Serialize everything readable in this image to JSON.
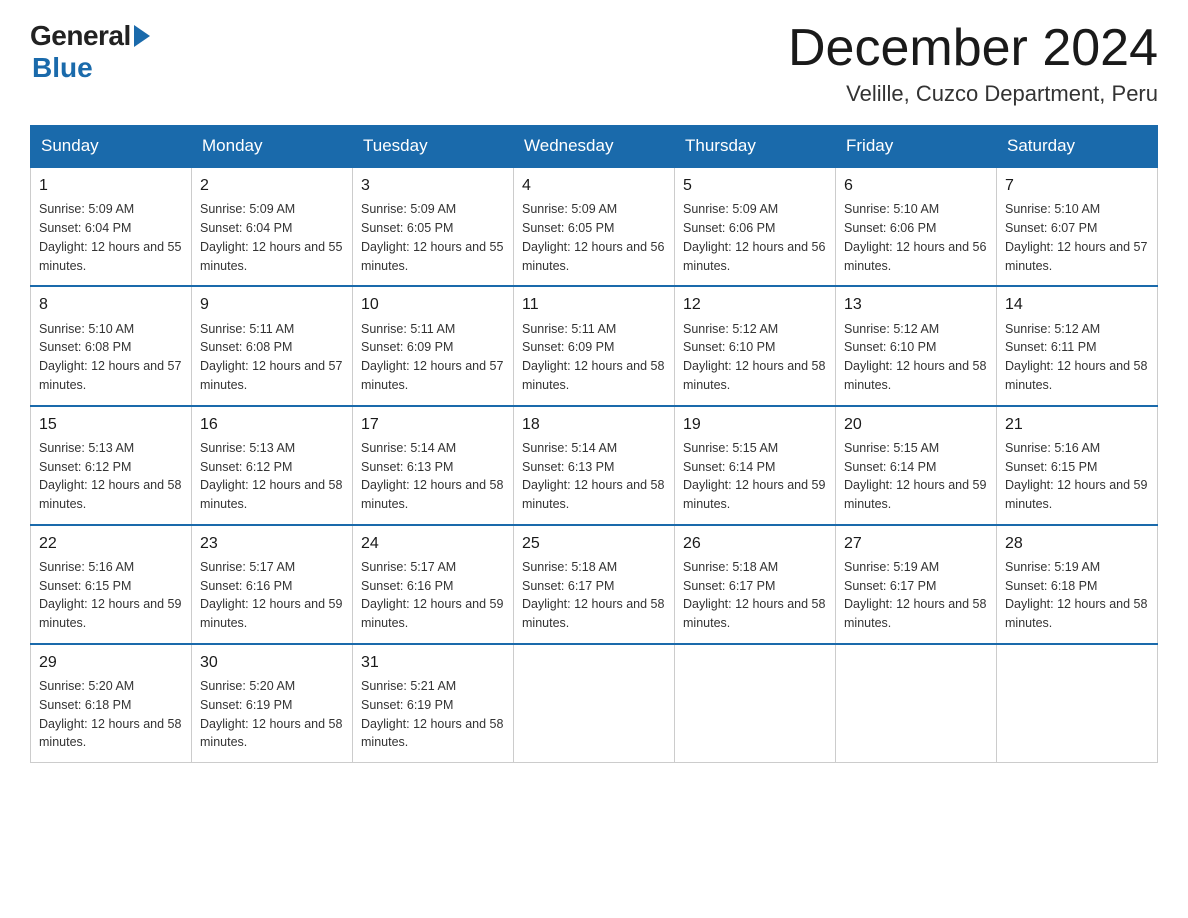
{
  "header": {
    "month_year": "December 2024",
    "location": "Velille, Cuzco Department, Peru"
  },
  "days_of_week": [
    "Sunday",
    "Monday",
    "Tuesday",
    "Wednesday",
    "Thursday",
    "Friday",
    "Saturday"
  ],
  "weeks": [
    [
      {
        "day": "1",
        "sunrise": "5:09 AM",
        "sunset": "6:04 PM",
        "daylight": "12 hours and 55 minutes."
      },
      {
        "day": "2",
        "sunrise": "5:09 AM",
        "sunset": "6:04 PM",
        "daylight": "12 hours and 55 minutes."
      },
      {
        "day": "3",
        "sunrise": "5:09 AM",
        "sunset": "6:05 PM",
        "daylight": "12 hours and 55 minutes."
      },
      {
        "day": "4",
        "sunrise": "5:09 AM",
        "sunset": "6:05 PM",
        "daylight": "12 hours and 56 minutes."
      },
      {
        "day": "5",
        "sunrise": "5:09 AM",
        "sunset": "6:06 PM",
        "daylight": "12 hours and 56 minutes."
      },
      {
        "day": "6",
        "sunrise": "5:10 AM",
        "sunset": "6:06 PM",
        "daylight": "12 hours and 56 minutes."
      },
      {
        "day": "7",
        "sunrise": "5:10 AM",
        "sunset": "6:07 PM",
        "daylight": "12 hours and 57 minutes."
      }
    ],
    [
      {
        "day": "8",
        "sunrise": "5:10 AM",
        "sunset": "6:08 PM",
        "daylight": "12 hours and 57 minutes."
      },
      {
        "day": "9",
        "sunrise": "5:11 AM",
        "sunset": "6:08 PM",
        "daylight": "12 hours and 57 minutes."
      },
      {
        "day": "10",
        "sunrise": "5:11 AM",
        "sunset": "6:09 PM",
        "daylight": "12 hours and 57 minutes."
      },
      {
        "day": "11",
        "sunrise": "5:11 AM",
        "sunset": "6:09 PM",
        "daylight": "12 hours and 58 minutes."
      },
      {
        "day": "12",
        "sunrise": "5:12 AM",
        "sunset": "6:10 PM",
        "daylight": "12 hours and 58 minutes."
      },
      {
        "day": "13",
        "sunrise": "5:12 AM",
        "sunset": "6:10 PM",
        "daylight": "12 hours and 58 minutes."
      },
      {
        "day": "14",
        "sunrise": "5:12 AM",
        "sunset": "6:11 PM",
        "daylight": "12 hours and 58 minutes."
      }
    ],
    [
      {
        "day": "15",
        "sunrise": "5:13 AM",
        "sunset": "6:12 PM",
        "daylight": "12 hours and 58 minutes."
      },
      {
        "day": "16",
        "sunrise": "5:13 AM",
        "sunset": "6:12 PM",
        "daylight": "12 hours and 58 minutes."
      },
      {
        "day": "17",
        "sunrise": "5:14 AM",
        "sunset": "6:13 PM",
        "daylight": "12 hours and 58 minutes."
      },
      {
        "day": "18",
        "sunrise": "5:14 AM",
        "sunset": "6:13 PM",
        "daylight": "12 hours and 58 minutes."
      },
      {
        "day": "19",
        "sunrise": "5:15 AM",
        "sunset": "6:14 PM",
        "daylight": "12 hours and 59 minutes."
      },
      {
        "day": "20",
        "sunrise": "5:15 AM",
        "sunset": "6:14 PM",
        "daylight": "12 hours and 59 minutes."
      },
      {
        "day": "21",
        "sunrise": "5:16 AM",
        "sunset": "6:15 PM",
        "daylight": "12 hours and 59 minutes."
      }
    ],
    [
      {
        "day": "22",
        "sunrise": "5:16 AM",
        "sunset": "6:15 PM",
        "daylight": "12 hours and 59 minutes."
      },
      {
        "day": "23",
        "sunrise": "5:17 AM",
        "sunset": "6:16 PM",
        "daylight": "12 hours and 59 minutes."
      },
      {
        "day": "24",
        "sunrise": "5:17 AM",
        "sunset": "6:16 PM",
        "daylight": "12 hours and 59 minutes."
      },
      {
        "day": "25",
        "sunrise": "5:18 AM",
        "sunset": "6:17 PM",
        "daylight": "12 hours and 58 minutes."
      },
      {
        "day": "26",
        "sunrise": "5:18 AM",
        "sunset": "6:17 PM",
        "daylight": "12 hours and 58 minutes."
      },
      {
        "day": "27",
        "sunrise": "5:19 AM",
        "sunset": "6:17 PM",
        "daylight": "12 hours and 58 minutes."
      },
      {
        "day": "28",
        "sunrise": "5:19 AM",
        "sunset": "6:18 PM",
        "daylight": "12 hours and 58 minutes."
      }
    ],
    [
      {
        "day": "29",
        "sunrise": "5:20 AM",
        "sunset": "6:18 PM",
        "daylight": "12 hours and 58 minutes."
      },
      {
        "day": "30",
        "sunrise": "5:20 AM",
        "sunset": "6:19 PM",
        "daylight": "12 hours and 58 minutes."
      },
      {
        "day": "31",
        "sunrise": "5:21 AM",
        "sunset": "6:19 PM",
        "daylight": "12 hours and 58 minutes."
      },
      null,
      null,
      null,
      null
    ]
  ],
  "labels": {
    "sunrise_prefix": "Sunrise: ",
    "sunset_prefix": "Sunset: ",
    "daylight_prefix": "Daylight: "
  }
}
